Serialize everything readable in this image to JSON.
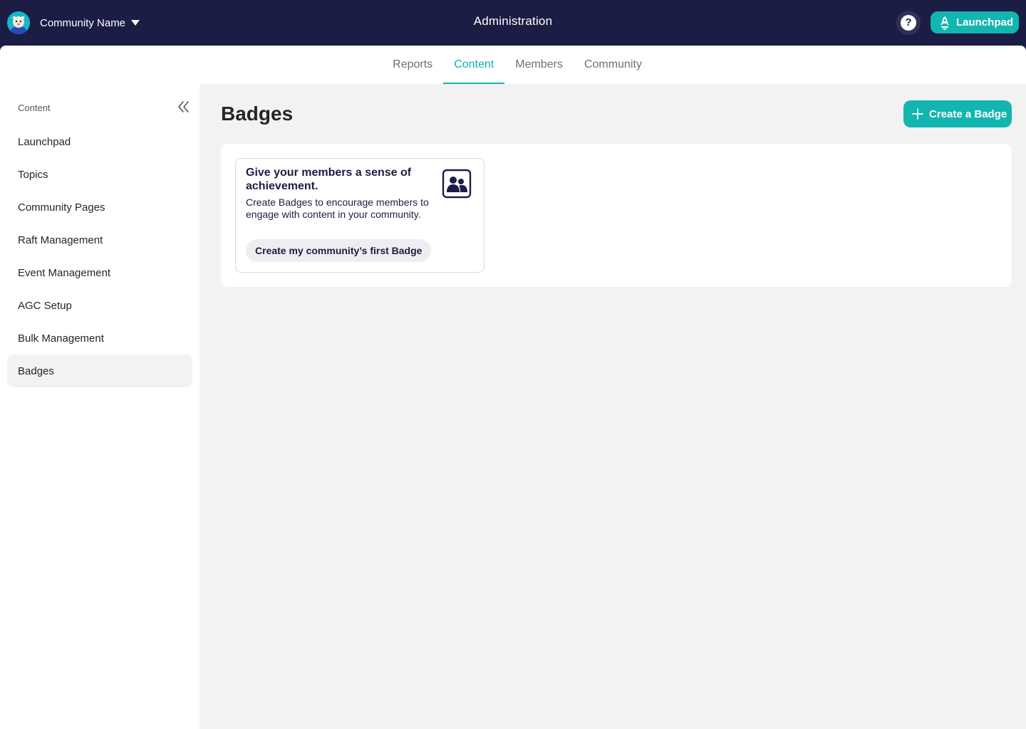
{
  "header": {
    "community_name": "Community Name",
    "title": "Administration",
    "help_label": "?",
    "launchpad_label": "Launchpad"
  },
  "tabs": [
    {
      "label": "Reports",
      "active": false
    },
    {
      "label": "Content",
      "active": true
    },
    {
      "label": "Members",
      "active": false
    },
    {
      "label": "Community",
      "active": false
    }
  ],
  "sidebar": {
    "heading": "Content",
    "items": [
      {
        "label": "Launchpad",
        "active": false
      },
      {
        "label": "Topics",
        "active": false
      },
      {
        "label": "Community Pages",
        "active": false
      },
      {
        "label": "Raft Management",
        "active": false
      },
      {
        "label": "Event Management",
        "active": false
      },
      {
        "label": "AGC Setup",
        "active": false
      },
      {
        "label": "Bulk Management",
        "active": false
      },
      {
        "label": "Badges",
        "active": true
      }
    ]
  },
  "main": {
    "title": "Badges",
    "create_button": "Create a Badge",
    "empty_card": {
      "title": "Give your members a sense of achievement.",
      "description": "Create Badges to encourage members to engage with content in your community.",
      "link": "Create my community’s first Badge",
      "icon": "members-badge-icon"
    }
  },
  "colors": {
    "header_bg": "#1c1d45",
    "accent": "#13b5b0",
    "content_bg": "#f2f2f2"
  }
}
